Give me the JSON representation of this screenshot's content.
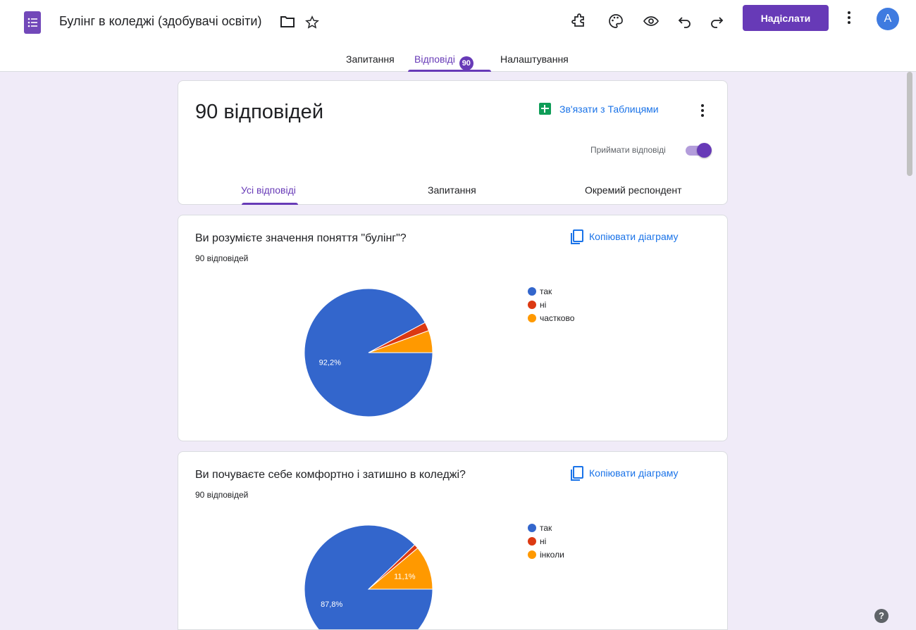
{
  "header": {
    "title": "Булінг в коледжі (здобувачі освіти)",
    "send_label": "Надіслати",
    "avatar_letter": "A"
  },
  "main_tabs": [
    {
      "label": "Запитання"
    },
    {
      "label": "Відповіді",
      "badge": "90"
    },
    {
      "label": "Налаштування"
    }
  ],
  "summary": {
    "count_text": "90 відповідей",
    "sheets_link": "Зв'язати з Таблицями",
    "accept_label": "Приймати відповіді",
    "accepting": true,
    "sub_tabs": [
      "Усі відповіді",
      "Запитання",
      "Окремий респондент"
    ]
  },
  "colors": {
    "accent": "#673ab7",
    "link": "#1a73e8",
    "series_blue": "#3366cc",
    "series_red": "#dc3912",
    "series_orange": "#ff9900"
  },
  "questions": [
    {
      "title": "Ви розумієте значення поняття \"булінг\"?",
      "count_text": "90 відповідей",
      "copy_label": "Копіювати діаграму"
    },
    {
      "title": "Ви почуваєте себе комфортно і затишно в коледжі?",
      "count_text": "90 відповідей",
      "copy_label": "Копіювати діаграму"
    }
  ],
  "chart_data": [
    {
      "type": "pie",
      "categories": [
        "так",
        "ні",
        "частково"
      ],
      "values": [
        92.2,
        2.2,
        5.6
      ],
      "labels": [
        "92,2%",
        "",
        ""
      ],
      "legend": "right"
    },
    {
      "type": "pie",
      "categories": [
        "так",
        "ні",
        "інколи"
      ],
      "values": [
        87.8,
        1.1,
        11.1
      ],
      "labels": [
        "87,8%",
        "",
        "11,1%"
      ],
      "legend": "right"
    }
  ]
}
